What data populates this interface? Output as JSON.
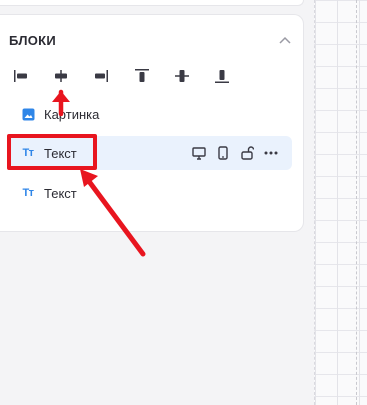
{
  "blocks_panel": {
    "title": "БЛОКИ",
    "collapse_icon": "chevron-up-icon"
  },
  "alignment_tools": [
    {
      "name": "align-left",
      "icon": "align-left-icon"
    },
    {
      "name": "align-center-horizontal",
      "icon": "align-center-horizontal-icon"
    },
    {
      "name": "align-right",
      "icon": "align-right-icon"
    },
    {
      "name": "align-top",
      "icon": "align-top-icon"
    },
    {
      "name": "align-center-vertical",
      "icon": "align-center-vertical-icon"
    },
    {
      "name": "align-bottom",
      "icon": "align-bottom-icon"
    }
  ],
  "layers": [
    {
      "label": "Картинка",
      "icon": "image-icon",
      "selected": false
    },
    {
      "label": "Текст",
      "icon_text": "Тт",
      "icon": "text-icon",
      "selected": true
    },
    {
      "label": "Текст",
      "icon_text": "Тт",
      "icon": "text-icon",
      "selected": false
    }
  ],
  "layer_actions": [
    "desktop-icon",
    "mobile-icon",
    "unlock-icon",
    "more-icon"
  ],
  "colors": {
    "accent": "#2f86e8",
    "selected_bg": "#eaf2fd",
    "annotation_red": "#e8151f"
  }
}
